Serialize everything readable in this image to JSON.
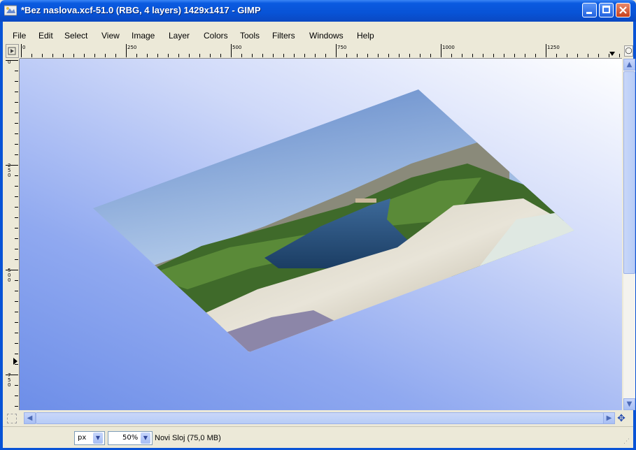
{
  "window": {
    "title": "*Bez naslova.xcf-51.0 (RBG, 4 layers) 1429x1417 - GIMP"
  },
  "menu": [
    {
      "label": "File"
    },
    {
      "label": "Edit"
    },
    {
      "label": "Select"
    },
    {
      "label": "View"
    },
    {
      "label": "Image"
    },
    {
      "label": "Layer"
    },
    {
      "label": "Colors"
    },
    {
      "label": "Tools"
    },
    {
      "label": "Filters"
    },
    {
      "label": "Windows"
    },
    {
      "label": "Help"
    }
  ],
  "rulers": {
    "horizontal_labels": [
      "0",
      "250",
      "500",
      "750",
      "1000",
      "1250"
    ],
    "vertical_labels": [
      "0",
      "250",
      "500",
      "750"
    ]
  },
  "canvas": {
    "gradient_colors": [
      "#ffffff",
      "#90a9f0",
      "#6d8ee8"
    ],
    "layer_content": "landscape photo (rotated, perspective-transformed)"
  },
  "statusbar": {
    "unit": "px",
    "zoom": "50%",
    "message": "Novi Sloj (75,0 MB)"
  },
  "icons": {
    "app": "gimp-icon",
    "nav": "navigate-icon",
    "zoom": "zoom-icon"
  }
}
